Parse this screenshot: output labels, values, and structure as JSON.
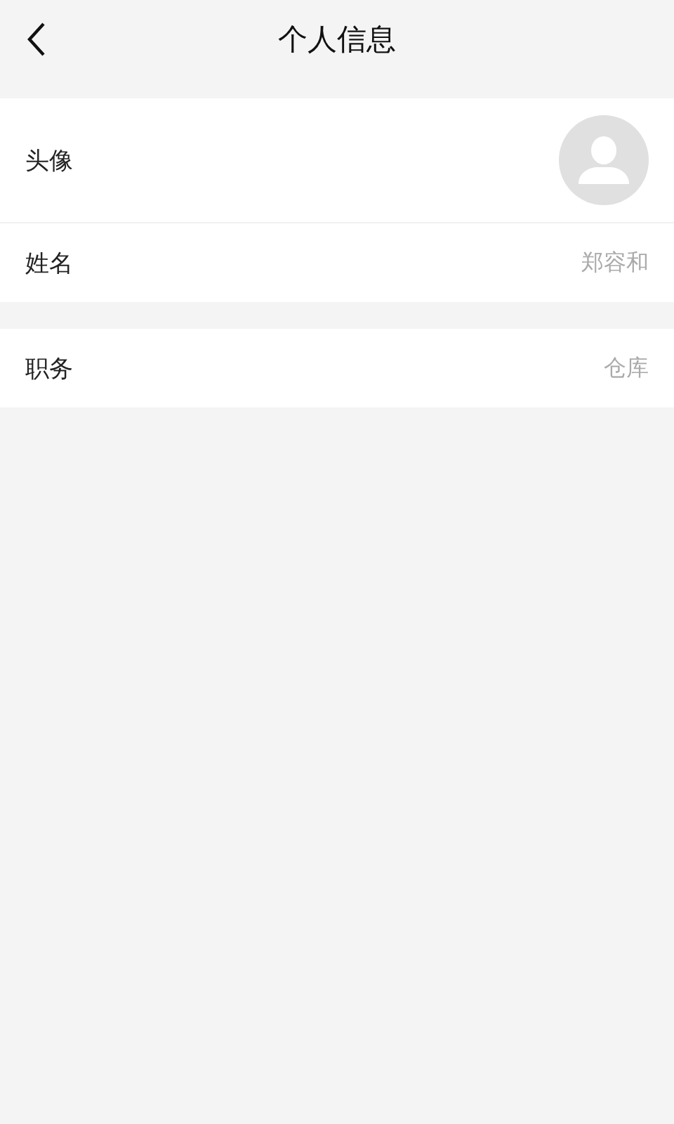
{
  "header": {
    "title": "个人信息"
  },
  "groups": [
    {
      "rows": [
        {
          "kind": "avatar",
          "label": "头像"
        },
        {
          "kind": "text",
          "label": "姓名",
          "value": "郑容和"
        }
      ]
    },
    {
      "rows": [
        {
          "kind": "text",
          "label": "职务",
          "value": "仓库"
        }
      ]
    }
  ]
}
